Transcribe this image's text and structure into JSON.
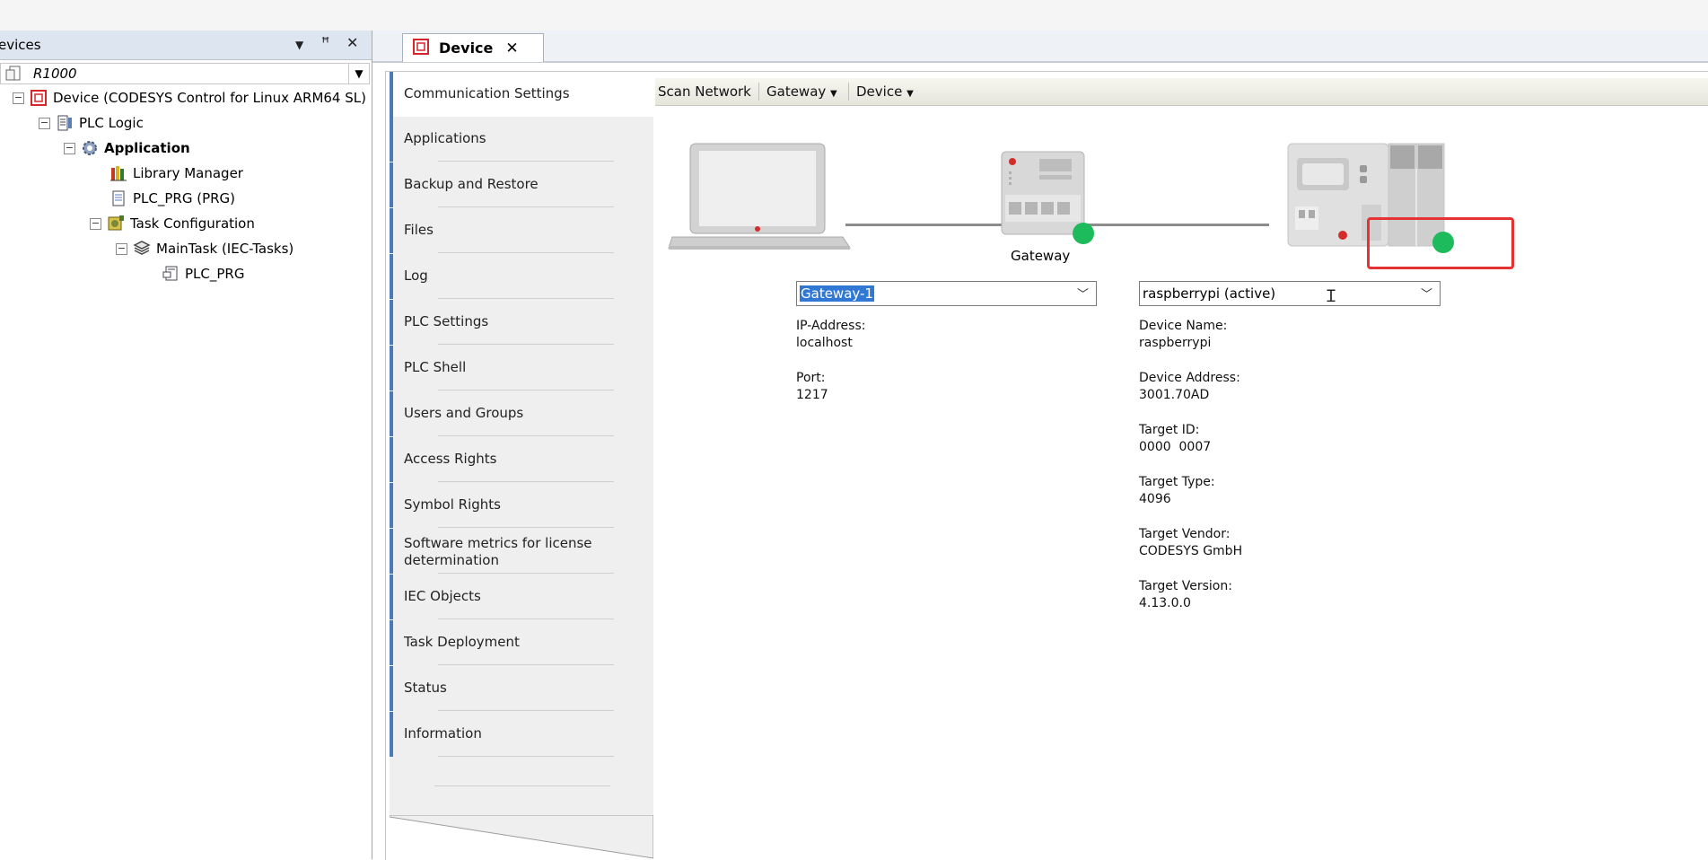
{
  "devices_pane": {
    "title": "evices",
    "buttons": {
      "dropdown": "▼",
      "pin": "ꟸ",
      "close": "✕"
    },
    "root": "R1000",
    "tree": {
      "device": "Device (CODESYS Control for Linux ARM64 SL)",
      "plc_logic": "PLC Logic",
      "application": "Application",
      "library_manager": "Library Manager",
      "plc_prg": "PLC_PRG (PRG)",
      "task_configuration": "Task Configuration",
      "main_task": "MainTask (IEC-Tasks)",
      "main_task_call": "PLC_PRG"
    }
  },
  "editor": {
    "tab_label": "Device",
    "nav": [
      "Communication Settings",
      "Applications",
      "Backup and Restore",
      "Files",
      "Log",
      "PLC Settings",
      "PLC Shell",
      "Users and Groups",
      "Access Rights",
      "Symbol Rights",
      "Software metrics for license determination",
      "IEC Objects",
      "Task Deployment",
      "Status",
      "Information"
    ],
    "toolbar": {
      "scan": "Scan Network",
      "gateway": "Gateway",
      "device": "Device"
    },
    "diagram": {
      "gateway_caption": "Gateway",
      "status_color": "#1dbb5b",
      "highlight_color": "#e53333"
    },
    "gateway": {
      "selected": "Gateway-1",
      "ip_label": "IP-Address:",
      "ip_value": "localhost",
      "port_label": "Port:",
      "port_value": "1217"
    },
    "device": {
      "selected": "raspberrypi (active)",
      "name_label": "Device Name:",
      "name_value": "raspberrypi",
      "address_label": "Device Address:",
      "address_value": "3001.70AD",
      "target_id_label": "Target ID:",
      "target_id_value": "0000  0007",
      "target_type_label": "Target Type:",
      "target_type_value": "4096",
      "vendor_label": "Target Vendor:",
      "vendor_value": "CODESYS GmbH",
      "version_label": "Target Version:",
      "version_value": "4.13.0.0"
    }
  }
}
